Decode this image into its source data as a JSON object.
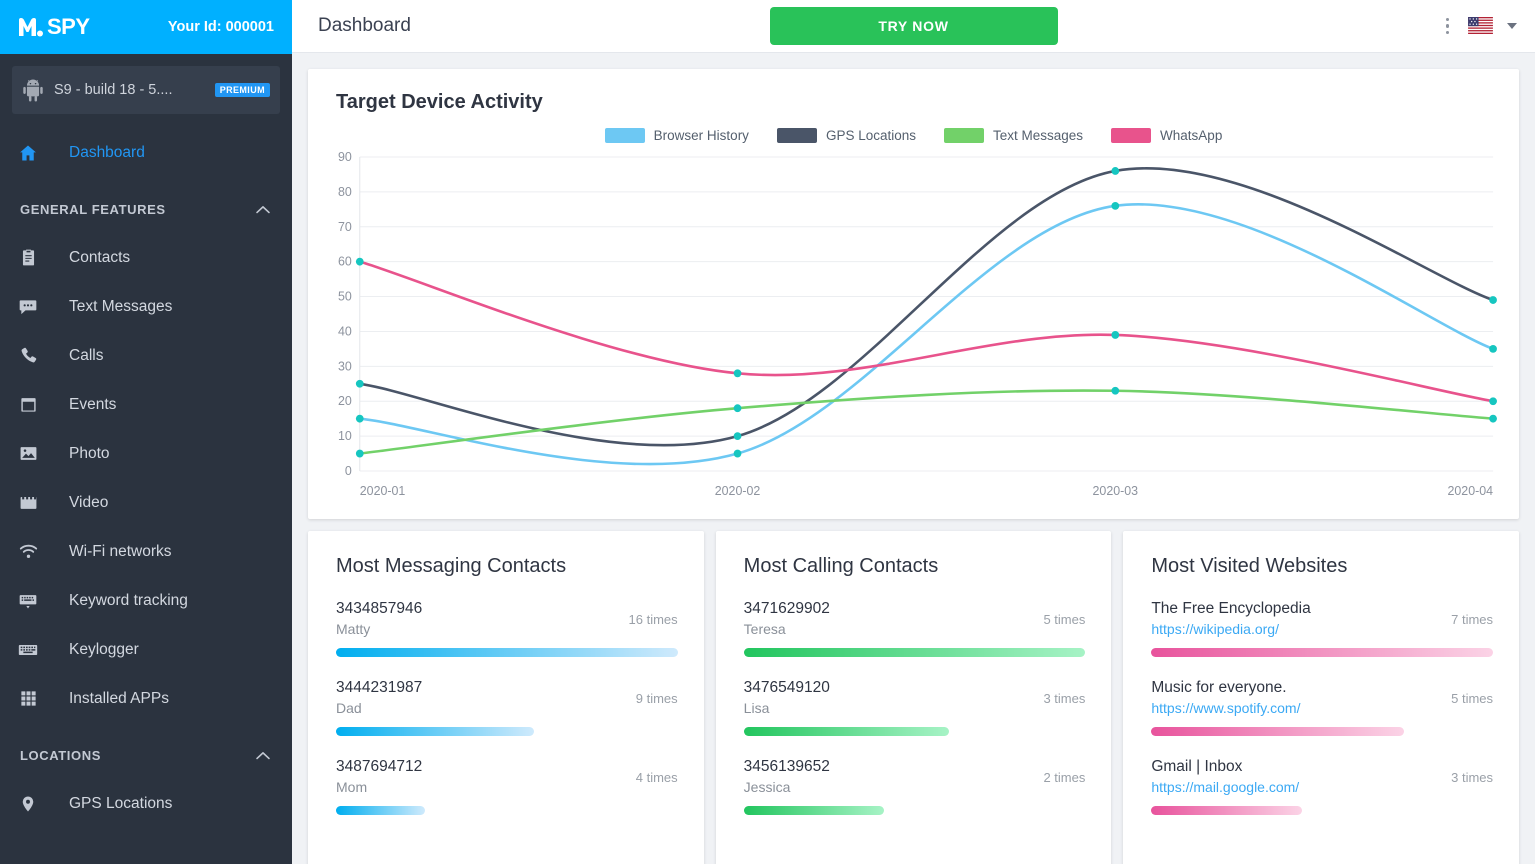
{
  "brand": {
    "logo_text": "SPY",
    "logo_mark": "m",
    "your_id": "Your Id: 000001"
  },
  "device": {
    "label": "S9 - build 18 - 5....",
    "badge": "PREMIUM",
    "icon": "android-icon"
  },
  "sidebar": {
    "dashboard": {
      "label": "Dashboard",
      "icon": "home-icon"
    },
    "group_general": {
      "label": "GENERAL FEATURES",
      "icon": "chevron-up-icon"
    },
    "general_items": [
      {
        "label": "Contacts",
        "icon": "contacts-icon"
      },
      {
        "label": "Text Messages",
        "icon": "message-icon"
      },
      {
        "label": "Calls",
        "icon": "phone-icon"
      },
      {
        "label": "Events",
        "icon": "calendar-icon"
      },
      {
        "label": "Photo",
        "icon": "image-icon"
      },
      {
        "label": "Video",
        "icon": "video-icon"
      },
      {
        "label": "Wi-Fi networks",
        "icon": "wifi-icon"
      },
      {
        "label": "Keyword tracking",
        "icon": "keyword-icon"
      },
      {
        "label": "Keylogger",
        "icon": "keyboard-icon"
      },
      {
        "label": "Installed APPs",
        "icon": "grid-icon"
      }
    ],
    "group_locations": {
      "label": "LOCATIONS",
      "icon": "chevron-up-icon"
    },
    "location_items": [
      {
        "label": "GPS Locations",
        "icon": "pin-icon"
      }
    ]
  },
  "topbar": {
    "title": "Dashboard",
    "try_now": "TRY NOW",
    "kebab": "more-options-icon",
    "flag": "us-flag-icon",
    "caret": "chevron-down-icon"
  },
  "chart_data": {
    "type": "line",
    "title": "Target Device Activity",
    "xlabel": "",
    "ylabel": "",
    "x": [
      "2020-01",
      "2020-02",
      "2020-03",
      "2020-04"
    ],
    "categories": [
      "2020-01",
      "2020-02",
      "2020-03",
      "2020-04"
    ],
    "ylim": [
      0,
      90
    ],
    "yticks": [
      0,
      10,
      20,
      30,
      40,
      50,
      60,
      70,
      80,
      90
    ],
    "grid": true,
    "legend_position": "top",
    "point_marker_color": "#16c6c0",
    "series": [
      {
        "name": "Browser History",
        "color": "#6dc8f3",
        "values": [
          15,
          5,
          76,
          35
        ]
      },
      {
        "name": "GPS Locations",
        "color": "#4a5568",
        "values": [
          25,
          10,
          86,
          49
        ]
      },
      {
        "name": "Text Messages",
        "color": "#72d169",
        "values": [
          5,
          18,
          23,
          15
        ]
      },
      {
        "name": "WhatsApp",
        "color": "#e8538c",
        "values": [
          60,
          28,
          39,
          20
        ]
      }
    ]
  },
  "cards": [
    {
      "title": "Most Messaging Contacts",
      "bar_from": "#00aeef",
      "bar_to": "#cfeafc",
      "rows": [
        {
          "primary": "3434857946",
          "secondary": "Matty",
          "count": "16 times",
          "pct": 100
        },
        {
          "primary": "3444231987",
          "secondary": "Dad",
          "count": "9 times",
          "pct": 58
        },
        {
          "primary": "3487694712",
          "secondary": "Mom",
          "count": "4 times",
          "pct": 26
        }
      ]
    },
    {
      "title": "Most Calling Contacts",
      "bar_from": "#22c55e",
      "bar_to": "#a7f3c6",
      "rows": [
        {
          "primary": "3471629902",
          "secondary": "Teresa",
          "count": "5 times",
          "pct": 100
        },
        {
          "primary": "3476549120",
          "secondary": "Lisa",
          "count": "3 times",
          "pct": 60
        },
        {
          "primary": "3456139652",
          "secondary": "Jessica",
          "count": "2 times",
          "pct": 41
        }
      ]
    },
    {
      "title": "Most Visited Websites",
      "bar_from": "#e8539c",
      "bar_to": "#fbd3e6",
      "rows": [
        {
          "primary": "The Free Encyclopedia",
          "secondary": "https://wikipedia.org/",
          "link": true,
          "count": "7 times",
          "pct": 100
        },
        {
          "primary": "Music for everyone.",
          "secondary": "https://www.spotify.com/",
          "link": true,
          "count": "5 times",
          "pct": 74
        },
        {
          "primary": "Gmail | Inbox",
          "secondary": "https://mail.google.com/",
          "link": true,
          "count": "3 times",
          "pct": 44
        }
      ]
    }
  ]
}
